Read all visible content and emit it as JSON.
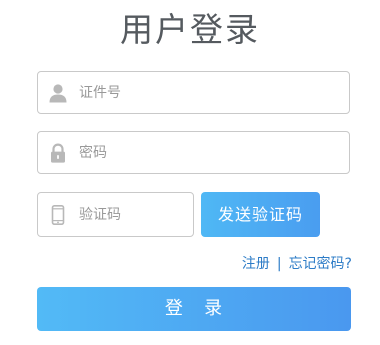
{
  "title": "用户登录",
  "username": {
    "placeholder": "证件号",
    "value": "",
    "icon": "user-icon"
  },
  "password": {
    "placeholder": "密码",
    "value": "",
    "icon": "lock-icon"
  },
  "verify_code": {
    "placeholder": "验证码",
    "value": "",
    "icon": "phone-icon"
  },
  "send_code_button": "发送验证码",
  "links": {
    "register": "注册",
    "separator": "|",
    "forgot_password": "忘记密码?"
  },
  "login_button": "登   录",
  "colors": {
    "title": "#555a5f",
    "button_start": "#52baf6",
    "button_end": "#4a98ef",
    "link": "#2d7cc7",
    "border": "#c9c9c9",
    "icon": "#b8b8b8"
  }
}
